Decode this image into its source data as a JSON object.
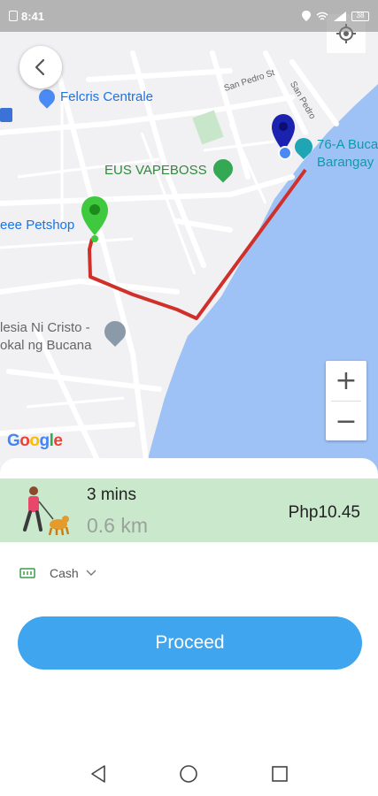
{
  "status_bar": {
    "time": "8:41",
    "battery": "38"
  },
  "map": {
    "labels": {
      "felcris": "Felcris Centrale",
      "san_pedro_1": "San Pedro St",
      "san_pedro_2": "San Pedro",
      "vapeboss": "EUS VAPEBOSS",
      "bucana_1": "76-A Buca",
      "bucana_2": "Barangay",
      "petshop": "eee Petshop",
      "church_1": "lesia Ni Cristo -",
      "church_2": "okal ng Bucana"
    },
    "google_logo": [
      "G",
      "o",
      "o",
      "g",
      "l",
      "e"
    ],
    "google_colors": [
      "#4285F4",
      "#EA4335",
      "#FBBC05",
      "#4285F4",
      "#34A853",
      "#EA4335"
    ],
    "route_color": "#d0302a",
    "water_color": "#9ec2f5"
  },
  "zoom": {
    "in": "+",
    "out": "−"
  },
  "ride_option": {
    "time": "3 mins",
    "distance": "0.6 km",
    "price": "Php10.45"
  },
  "payment": {
    "method": "Cash"
  },
  "proceed_label": "Proceed",
  "colors": {
    "option_bg": "#c9e8cc",
    "accent": "#3ea5ee"
  }
}
